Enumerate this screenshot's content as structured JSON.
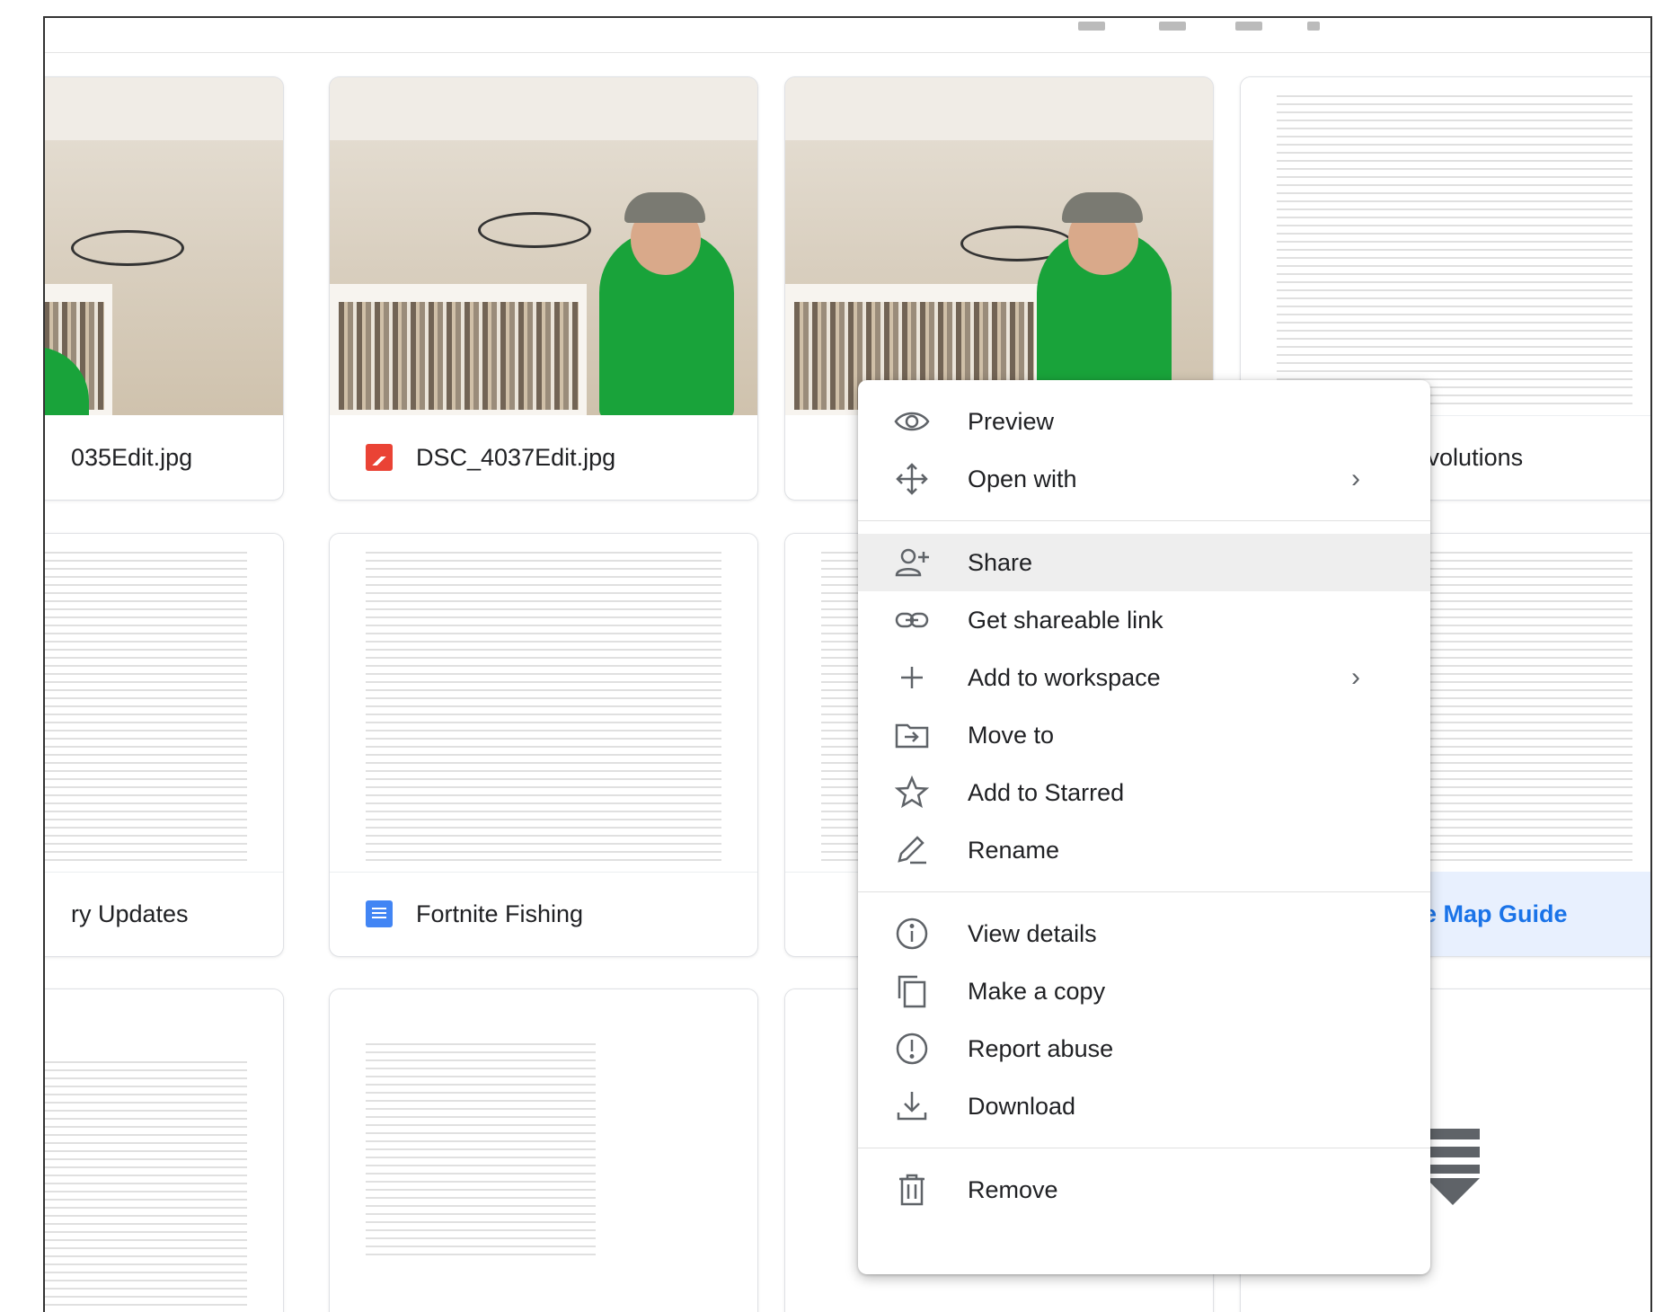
{
  "files": [
    {
      "name": "035Edit.jpg",
      "type": "image"
    },
    {
      "name": "DSC_4037Edit.jpg",
      "type": "image"
    },
    {
      "name": "",
      "type": "image"
    },
    {
      "name": "e evolutions",
      "type": "doc"
    },
    {
      "name": "ry Updates",
      "type": "doc"
    },
    {
      "name": "Fortnite Fishing",
      "type": "doc"
    },
    {
      "name": "nite Map Guide",
      "type": "doc"
    }
  ],
  "context_menu": {
    "preview": "Preview",
    "open_with": "Open with",
    "share": "Share",
    "get_link": "Get shareable link",
    "add_workspace": "Add to workspace",
    "move_to": "Move to",
    "add_starred": "Add to Starred",
    "rename": "Rename",
    "view_details": "View details",
    "make_copy": "Make a copy",
    "report_abuse": "Report abuse",
    "download": "Download",
    "remove": "Remove"
  },
  "colors": {
    "accent": "#1a73e8",
    "selected_bg": "#e8f0fe",
    "image_icon": "#ea4335",
    "doc_icon": "#4285f4",
    "shirt": "#19a33a"
  },
  "icons": [
    "eye-icon",
    "move-arrows-icon",
    "person-add-icon",
    "link-icon",
    "plus-icon",
    "folder-move-icon",
    "star-icon",
    "pencil-icon",
    "info-icon",
    "copy-icon",
    "alert-icon",
    "download-icon",
    "trash-icon",
    "chevron-right-icon",
    "image-file-icon",
    "doc-file-icon",
    "scroll-down-icon"
  ]
}
